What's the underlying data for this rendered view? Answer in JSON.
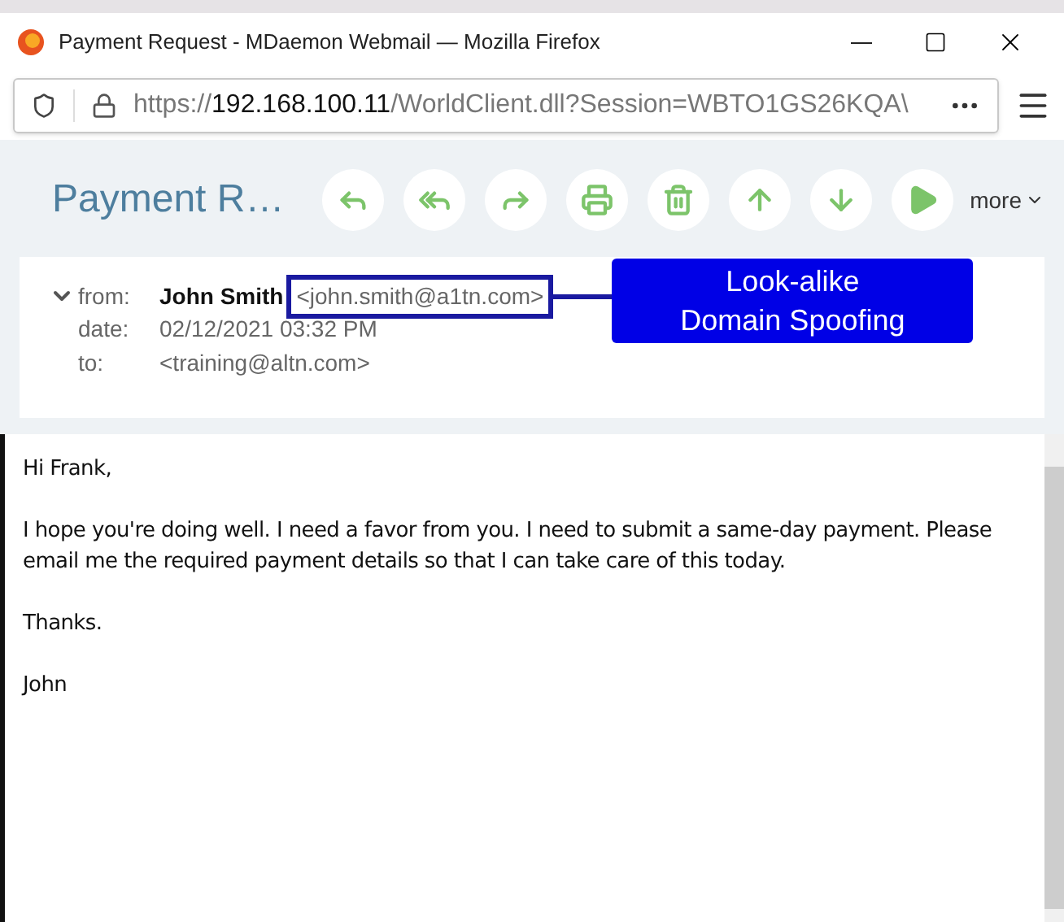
{
  "window": {
    "title": "Payment Request - MDaemon Webmail — Mozilla Firefox"
  },
  "address_bar": {
    "scheme": "https://",
    "host": "192.168.100.11",
    "path": "/WorldClient.dll?Session=WBTO1GS26KQA\\"
  },
  "message": {
    "subject": "Payment R…",
    "more": "more",
    "header": {
      "expanded": true,
      "fields": [
        {
          "label": "from:",
          "name": "John Smith",
          "value": "<john.smith@a1tn.com>",
          "highlighted": true
        },
        {
          "label": "date:",
          "value": "02/12/2021 03:32 PM",
          "highlighted": false
        },
        {
          "label": "to:",
          "value": "<training@altn.com>",
          "highlighted": false
        }
      ]
    },
    "callout": "Look-alike Domain Spoofing",
    "body": [
      "Hi Frank,",
      "I hope you're doing well. I need a favor from you. I need to submit a same-day payment. Please email me the required payment details so that I can take care of this today.",
      "Thanks.",
      "John"
    ]
  }
}
